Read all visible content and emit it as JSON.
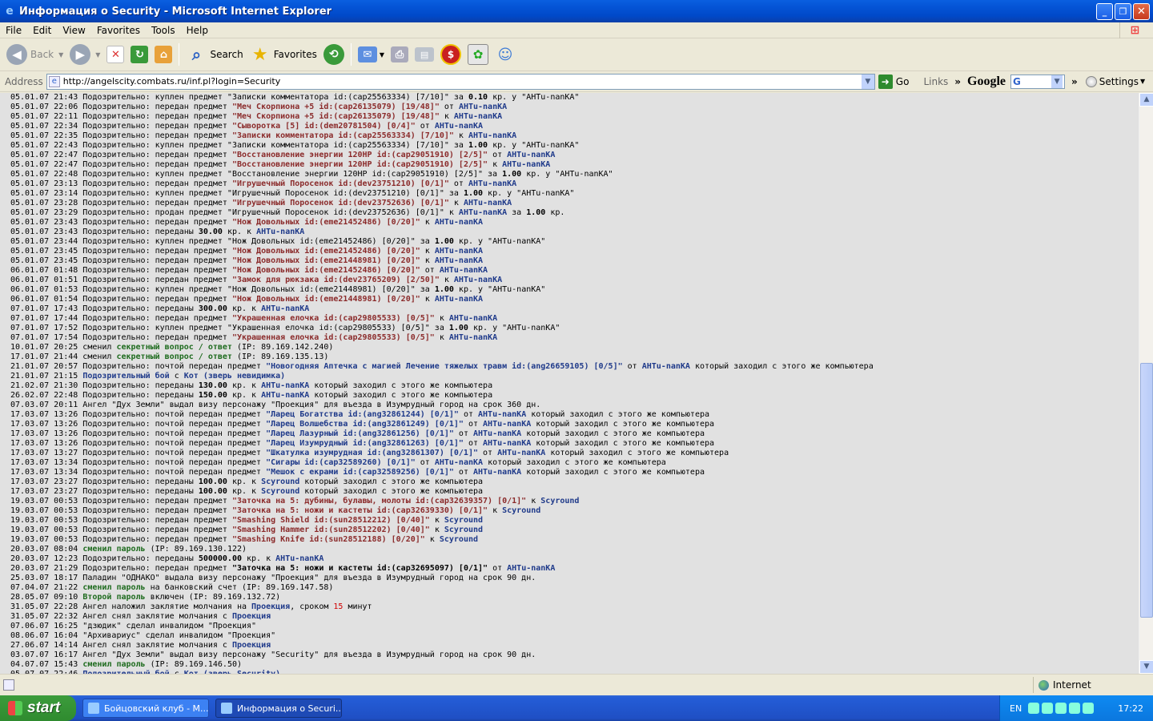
{
  "window": {
    "title": "Информация о Security - Microsoft Internet Explorer"
  },
  "menu": [
    "File",
    "Edit",
    "View",
    "Favorites",
    "Tools",
    "Help"
  ],
  "toolbar": {
    "back": "Back",
    "search": "Search",
    "favorites": "Favorites"
  },
  "address": {
    "label": "Address",
    "url": "http://angelscity.combats.ru/inf.pl?login=Security",
    "go": "Go",
    "links": "Links",
    "google": "Google",
    "google_sel": "G",
    "settings": "Settings"
  },
  "status": {
    "zone": "Internet"
  },
  "taskbar": {
    "start": "start",
    "tasks": [
      "Бойцовский клуб - М...",
      "Информация о Securi..."
    ],
    "lang": "EN",
    "clock": "17:22"
  },
  "colors": {
    "item": "#8b2b2b",
    "nick": "#1f3a8a",
    "green": "#1e6b1e",
    "content_bg": "#e1e1e1"
  },
  "log": [
    [
      [
        "05.01.07 21:43 Подозрительно: куплен предмет \"Записки комментатора id:(cap25563334) [7/10]\" за ",
        ""
      ],
      [
        "0.10",
        "num"
      ],
      [
        " кр. у \"AHTu-nanKA\"",
        ""
      ]
    ],
    [
      [
        "05.01.07 22:06 Подозрительно: передан предмет ",
        ""
      ],
      [
        "\"Меч Скорпиона +5 id:(cap26135079) [19/48]\"",
        "item"
      ],
      [
        " от ",
        ""
      ],
      [
        "AHTu-nanKA",
        "nick"
      ]
    ],
    [
      [
        "05.01.07 22:11 Подозрительно: передан предмет ",
        ""
      ],
      [
        "\"Меч Скорпиона +5 id:(cap26135079) [19/48]\"",
        "item"
      ],
      [
        " к ",
        ""
      ],
      [
        "AHTu-nanKA",
        "nick"
      ]
    ],
    [
      [
        "05.01.07 22:34 Подозрительно: передан предмет ",
        ""
      ],
      [
        "\"Сыворотка [5] id:(dem20781504) [0/4]\"",
        "item"
      ],
      [
        " от ",
        ""
      ],
      [
        "AHTu-nanKA",
        "nick"
      ]
    ],
    [
      [
        "05.01.07 22:35 Подозрительно: передан предмет ",
        ""
      ],
      [
        "\"Записки комментатора id:(cap25563334) [7/10]\"",
        "item"
      ],
      [
        " к ",
        ""
      ],
      [
        "AHTu-nanKA",
        "nick"
      ]
    ],
    [
      [
        "05.01.07 22:43 Подозрительно: куплен предмет \"Записки комментатора id:(cap25563334) [7/10]\" за ",
        ""
      ],
      [
        "1.00",
        "num"
      ],
      [
        " кр. у \"AHTu-nanKA\"",
        ""
      ]
    ],
    [
      [
        "05.01.07 22:47 Подозрительно: передан предмет ",
        ""
      ],
      [
        "\"Восстановление энергии 120HP id:(cap29051910) [2/5]\"",
        "item"
      ],
      [
        " от ",
        ""
      ],
      [
        "AHTu-nanKA",
        "nick"
      ]
    ],
    [
      [
        "05.01.07 22:47 Подозрительно: передан предмет ",
        ""
      ],
      [
        "\"Восстановление энергии 120HP id:(cap29051910) [2/5]\"",
        "item"
      ],
      [
        " к ",
        ""
      ],
      [
        "AHTu-nanKA",
        "nick"
      ]
    ],
    [
      [
        "05.01.07 22:48 Подозрительно: куплен предмет \"Восстановление энергии 120HP id:(cap29051910) [2/5]\" за ",
        ""
      ],
      [
        "1.00",
        "num"
      ],
      [
        " кр. у \"AHTu-nanKA\"",
        ""
      ]
    ],
    [
      [
        "05.01.07 23:13 Подозрительно: передан предмет ",
        ""
      ],
      [
        "\"Игрушечный Поросенок id:(dev23751210) [0/1]\"",
        "item"
      ],
      [
        " от ",
        ""
      ],
      [
        "AHTu-nanKA",
        "nick"
      ]
    ],
    [
      [
        "05.01.07 23:14 Подозрительно: куплен предмет \"Игрушечный Поросенок id:(dev23751210) [0/1]\" за ",
        ""
      ],
      [
        "1.00",
        "num"
      ],
      [
        " кр. у \"AHTu-nanKA\"",
        ""
      ]
    ],
    [
      [
        "05.01.07 23:28 Подозрительно: передан предмет ",
        ""
      ],
      [
        "\"Игрушечный Поросенок id:(dev23752636) [0/1]\"",
        "item"
      ],
      [
        " к ",
        ""
      ],
      [
        "AHTu-nanKA",
        "nick"
      ]
    ],
    [
      [
        "05.01.07 23:29 Подозрительно: продан предмет \"Игрушечный Поросенок id:(dev23752636) [0/1]\" к ",
        ""
      ],
      [
        "AHTu-nanKA",
        "nick"
      ],
      [
        " за ",
        ""
      ],
      [
        "1.00",
        "num"
      ],
      [
        " кр.",
        ""
      ]
    ],
    [
      [
        "05.01.07 23:43 Подозрительно: передан предмет ",
        ""
      ],
      [
        "\"Нож Довольных id:(eme21452486) [0/20]\"",
        "item"
      ],
      [
        " к ",
        ""
      ],
      [
        "AHTu-nanKA",
        "nick"
      ]
    ],
    [
      [
        "05.01.07 23:43 Подозрительно: переданы ",
        ""
      ],
      [
        "30.00",
        "num"
      ],
      [
        " кр. к ",
        ""
      ],
      [
        "AHTu-nanKA",
        "nick"
      ]
    ],
    [
      [
        "05.01.07 23:44 Подозрительно: куплен предмет \"Нож Довольных id:(eme21452486) [0/20]\" за ",
        ""
      ],
      [
        "1.00",
        "num"
      ],
      [
        " кр. у \"AHTu-nanKA\"",
        ""
      ]
    ],
    [
      [
        "05.01.07 23:45 Подозрительно: передан предмет ",
        ""
      ],
      [
        "\"Нож Довольных id:(eme21452486) [0/20]\"",
        "item"
      ],
      [
        " к ",
        ""
      ],
      [
        "AHTu-nanKA",
        "nick"
      ]
    ],
    [
      [
        "05.01.07 23:45 Подозрительно: передан предмет ",
        ""
      ],
      [
        "\"Нож Довольных id:(eme21448981) [0/20]\"",
        "item"
      ],
      [
        " к ",
        ""
      ],
      [
        "AHTu-nanKA",
        "nick"
      ]
    ],
    [
      [
        "06.01.07 01:48 Подозрительно: передан предмет ",
        ""
      ],
      [
        "\"Нож Довольных id:(eme21452486) [0/20]\"",
        "item"
      ],
      [
        " от ",
        ""
      ],
      [
        "AHTu-nanKA",
        "nick"
      ]
    ],
    [
      [
        "06.01.07 01:51 Подозрительно: передан предмет ",
        ""
      ],
      [
        "\"Замок для рюкзака id:(dev23765209) [2/50]\"",
        "item"
      ],
      [
        " к ",
        ""
      ],
      [
        "AHTu-nanKA",
        "nick"
      ]
    ],
    [
      [
        "06.01.07 01:53 Подозрительно: куплен предмет \"Нож Довольных id:(eme21448981) [0/20]\" за ",
        ""
      ],
      [
        "1.00",
        "num"
      ],
      [
        " кр. у \"AHTu-nanKA\"",
        ""
      ]
    ],
    [
      [
        "06.01.07 01:54 Подозрительно: передан предмет ",
        ""
      ],
      [
        "\"Нож Довольных id:(eme21448981) [0/20]\"",
        "item"
      ],
      [
        " к ",
        ""
      ],
      [
        "AHTu-nanKA",
        "nick"
      ]
    ],
    [
      [
        "07.01.07 17:43 Подозрительно: переданы ",
        ""
      ],
      [
        "300.00",
        "num"
      ],
      [
        " кр. к ",
        ""
      ],
      [
        "AHTu-nanKA",
        "nick"
      ]
    ],
    [
      [
        "07.01.07 17:44 Подозрительно: передан предмет ",
        ""
      ],
      [
        "\"Украшенная елочка id:(cap29805533) [0/5]\"",
        "item"
      ],
      [
        " к ",
        ""
      ],
      [
        "AHTu-nanKA",
        "nick"
      ]
    ],
    [
      [
        "07.01.07 17:52 Подозрительно: куплен предмет \"Украшенная елочка id:(cap29805533) [0/5]\" за ",
        ""
      ],
      [
        "1.00",
        "num"
      ],
      [
        " кр. у \"AHTu-nanKA\"",
        ""
      ]
    ],
    [
      [
        "07.01.07 17:54 Подозрительно: передан предмет ",
        ""
      ],
      [
        "\"Украшенная елочка id:(cap29805533) [0/5]\"",
        "item"
      ],
      [
        " к ",
        ""
      ],
      [
        "AHTu-nanKA",
        "nick"
      ]
    ],
    [
      [
        "10.01.07 20:25 сменил ",
        ""
      ],
      [
        "секретный вопрос / ответ",
        "green"
      ],
      [
        " (IP: 89.169.142.240)",
        ""
      ]
    ],
    [
      [
        "17.01.07 21:44 сменил ",
        ""
      ],
      [
        "секретный вопрос / ответ",
        "green"
      ],
      [
        " (IP: 89.169.135.13)",
        ""
      ]
    ],
    [
      [
        "21.01.07 20:57 Подозрительно: почтой передан предмет ",
        ""
      ],
      [
        "\"Новогодняя Аптечка с магией Лечение тяжелых травм id:(ang26659105) [0/5]\"",
        "nick"
      ],
      [
        " от ",
        ""
      ],
      [
        "AHTu-nanKA",
        "nick"
      ],
      [
        " который заходил с этого же компьютера",
        ""
      ]
    ],
    [
      [
        "21.01.07 21:15 ",
        ""
      ],
      [
        "Подозрительный бой",
        "blue"
      ],
      [
        " с ",
        ""
      ],
      [
        "Кот (зверь ",
        "blue"
      ],
      [
        "невидимка",
        "blue"
      ],
      [
        ")",
        "blue"
      ]
    ],
    [
      [
        "21.02.07 21:30 Подозрительно: переданы ",
        ""
      ],
      [
        "130.00",
        "num"
      ],
      [
        " кр. к ",
        ""
      ],
      [
        "AHTu-nanKA",
        "nick"
      ],
      [
        " который заходил с этого же компьютера",
        ""
      ]
    ],
    [
      [
        "26.02.07 22:48 Подозрительно: переданы ",
        ""
      ],
      [
        "150.00",
        "num"
      ],
      [
        " кр. к ",
        ""
      ],
      [
        "AHTu-nanKA",
        "nick"
      ],
      [
        " который заходил с этого же компьютера",
        ""
      ]
    ],
    [
      [
        "07.03.07 20:11 Ангел \"Дух Земли\" выдал визу персонажу \"Проекция\" для въезда в Изумрудный город на срок 360 дн.",
        ""
      ]
    ],
    [
      [
        "17.03.07 13:26 Подозрительно: почтой передан предмет ",
        ""
      ],
      [
        "\"Ларец Богатства id:(ang32861244) [0/1]\"",
        "nick"
      ],
      [
        " от ",
        ""
      ],
      [
        "AHTu-nanKA",
        "nick"
      ],
      [
        " который заходил с этого же компьютера",
        ""
      ]
    ],
    [
      [
        "17.03.07 13:26 Подозрительно: почтой передан предмет ",
        ""
      ],
      [
        "\"Ларец Волшебства id:(ang32861249) [0/1]\"",
        "nick"
      ],
      [
        " от ",
        ""
      ],
      [
        "AHTu-nanKA",
        "nick"
      ],
      [
        " который заходил с этого же компьютера",
        ""
      ]
    ],
    [
      [
        "17.03.07 13:26 Подозрительно: почтой передан предмет ",
        ""
      ],
      [
        "\"Ларец Лазурный id:(ang32861256) [0/1]\"",
        "nick"
      ],
      [
        " от ",
        ""
      ],
      [
        "AHTu-nanKA",
        "nick"
      ],
      [
        " который заходил с этого же компьютера",
        ""
      ]
    ],
    [
      [
        "17.03.07 13:26 Подозрительно: почтой передан предмет ",
        ""
      ],
      [
        "\"Ларец Изумрудный id:(ang32861263) [0/1]\"",
        "nick"
      ],
      [
        " от ",
        ""
      ],
      [
        "AHTu-nanKA",
        "nick"
      ],
      [
        " который заходил с этого же компьютера",
        ""
      ]
    ],
    [
      [
        "17.03.07 13:27 Подозрительно: почтой передан предмет ",
        ""
      ],
      [
        "\"Шкатулка изумрудная id:(ang32861307) [0/1]\"",
        "nick"
      ],
      [
        " от ",
        ""
      ],
      [
        "AHTu-nanKA",
        "nick"
      ],
      [
        " который заходил с этого же компьютера",
        ""
      ]
    ],
    [
      [
        "17.03.07 13:34 Подозрительно: почтой передан предмет ",
        ""
      ],
      [
        "\"Сигары id:(cap32589260) [0/1]\"",
        "nick"
      ],
      [
        " от ",
        ""
      ],
      [
        "AHTu-nanKA",
        "nick"
      ],
      [
        " который заходил с этого же компьютера",
        ""
      ]
    ],
    [
      [
        "17.03.07 13:34 Подозрительно: почтой передан предмет ",
        ""
      ],
      [
        "\"Мешок с екрами id:(cap32589256) [0/1]\"",
        "nick"
      ],
      [
        " от ",
        ""
      ],
      [
        "AHTu-nanKA",
        "nick"
      ],
      [
        " который заходил с этого же компьютера",
        ""
      ]
    ],
    [
      [
        "17.03.07 23:27 Подозрительно: переданы ",
        ""
      ],
      [
        "100.00",
        "num"
      ],
      [
        " кр. к ",
        ""
      ],
      [
        "Scyround",
        "nick"
      ],
      [
        " который заходил с этого же компьютера",
        ""
      ]
    ],
    [
      [
        "17.03.07 23:27 Подозрительно: переданы ",
        ""
      ],
      [
        "100.00",
        "num"
      ],
      [
        " кр. к ",
        ""
      ],
      [
        "Scyround",
        "nick"
      ],
      [
        " который заходил с этого же компьютера",
        ""
      ]
    ],
    [
      [
        "19.03.07 00:53 Подозрительно: передан предмет ",
        ""
      ],
      [
        "\"Заточка на 5: дубины, булавы, молоты id:(cap32639357) [0/1]\"",
        "item"
      ],
      [
        " к ",
        ""
      ],
      [
        "Scyround",
        "nick"
      ]
    ],
    [
      [
        "19.03.07 00:53 Подозрительно: передан предмет ",
        ""
      ],
      [
        "\"Заточка на 5: ножи и кастеты id:(cap32639330) [0/1]\"",
        "item"
      ],
      [
        " к ",
        ""
      ],
      [
        "Scyround",
        "nick"
      ]
    ],
    [
      [
        "19.03.07 00:53 Подозрительно: передан предмет ",
        ""
      ],
      [
        "\"Smashing Shield id:(sun28512212) [0/40]\"",
        "item"
      ],
      [
        " к ",
        ""
      ],
      [
        "Scyround",
        "nick"
      ]
    ],
    [
      [
        "19.03.07 00:53 Подозрительно: передан предмет ",
        ""
      ],
      [
        "\"Smashing Hammer id:(sun28512202) [0/40]\"",
        "item"
      ],
      [
        " к ",
        ""
      ],
      [
        "Scyround",
        "nick"
      ]
    ],
    [
      [
        "19.03.07 00:53 Подозрительно: передан предмет ",
        ""
      ],
      [
        "\"Smashing Knife id:(sun28512188) [0/20]\"",
        "item"
      ],
      [
        " к ",
        ""
      ],
      [
        "Scyround",
        "nick"
      ]
    ],
    [
      [
        "20.03.07 08:04 ",
        ""
      ],
      [
        "сменил пароль",
        "green"
      ],
      [
        " (IP: 89.169.130.122)",
        ""
      ]
    ],
    [
      [
        "20.03.07 12:23 Подозрительно: переданы ",
        ""
      ],
      [
        "500000.00",
        "num"
      ],
      [
        " кр. к ",
        ""
      ],
      [
        "AHTu-nanKA",
        "nick"
      ]
    ],
    [
      [
        "20.03.07 21:29 Подозрительно: передан предмет ",
        ""
      ],
      [
        "\"Заточка на 5: ножи и кастеты id:(cap32695097) [0/1]\"",
        "num"
      ],
      [
        " от ",
        ""
      ],
      [
        "AHTu-nanKA",
        "nick"
      ]
    ],
    [
      [
        "25.03.07 18:17 Паладин \"ОДНАКО\" выдала визу персонажу \"Проекция\" для въезда в Изумрудный город на срок 90 дн.",
        ""
      ]
    ],
    [
      [
        "07.04.07 21:22 ",
        ""
      ],
      [
        "сменил пароль",
        "green"
      ],
      [
        " на банковский счет (IP: 89.169.147.58)",
        ""
      ]
    ],
    [
      [
        "28.05.07 09:10 ",
        ""
      ],
      [
        "Второй пароль",
        "green"
      ],
      [
        " включен (IP: 89.169.132.72)",
        ""
      ]
    ],
    [
      [
        "31.05.07 22:28 Ангел наложил заклятие молчания на ",
        ""
      ],
      [
        "Проекция",
        "nick"
      ],
      [
        ", сроком ",
        ""
      ],
      [
        "15",
        "red"
      ],
      [
        " минут",
        ""
      ]
    ],
    [
      [
        "31.05.07 22:32 Ангел снял заклятие молчания с ",
        ""
      ],
      [
        "Проекция",
        "nick"
      ]
    ],
    [
      [
        "07.06.07 16:25 \"дзюдик\" сделал инвалидом \"Проекция\"",
        ""
      ]
    ],
    [
      [
        "08.06.07 16:04 \"Архивариус\" сделал инвалидом \"Проекция\"",
        ""
      ]
    ],
    [
      [
        "27.06.07 14:14 Ангел снял заклятие молчания с ",
        ""
      ],
      [
        "Проекция",
        "nick"
      ]
    ],
    [
      [
        "03.07.07 16:17 Ангел \"Дух Земли\" выдал визу персонажу \"Security\" для въезда в Изумрудный город на срок 90 дн.",
        ""
      ]
    ],
    [
      [
        "04.07.07 15:43 ",
        ""
      ],
      [
        "сменил пароль",
        "green"
      ],
      [
        " (IP: 89.169.146.50)",
        ""
      ]
    ],
    [
      [
        "05.07.07 22:46 ",
        ""
      ],
      [
        "Подозрительный бой",
        "blue"
      ],
      [
        " с ",
        ""
      ],
      [
        "Кот (зверь Security)",
        "blue"
      ]
    ]
  ]
}
